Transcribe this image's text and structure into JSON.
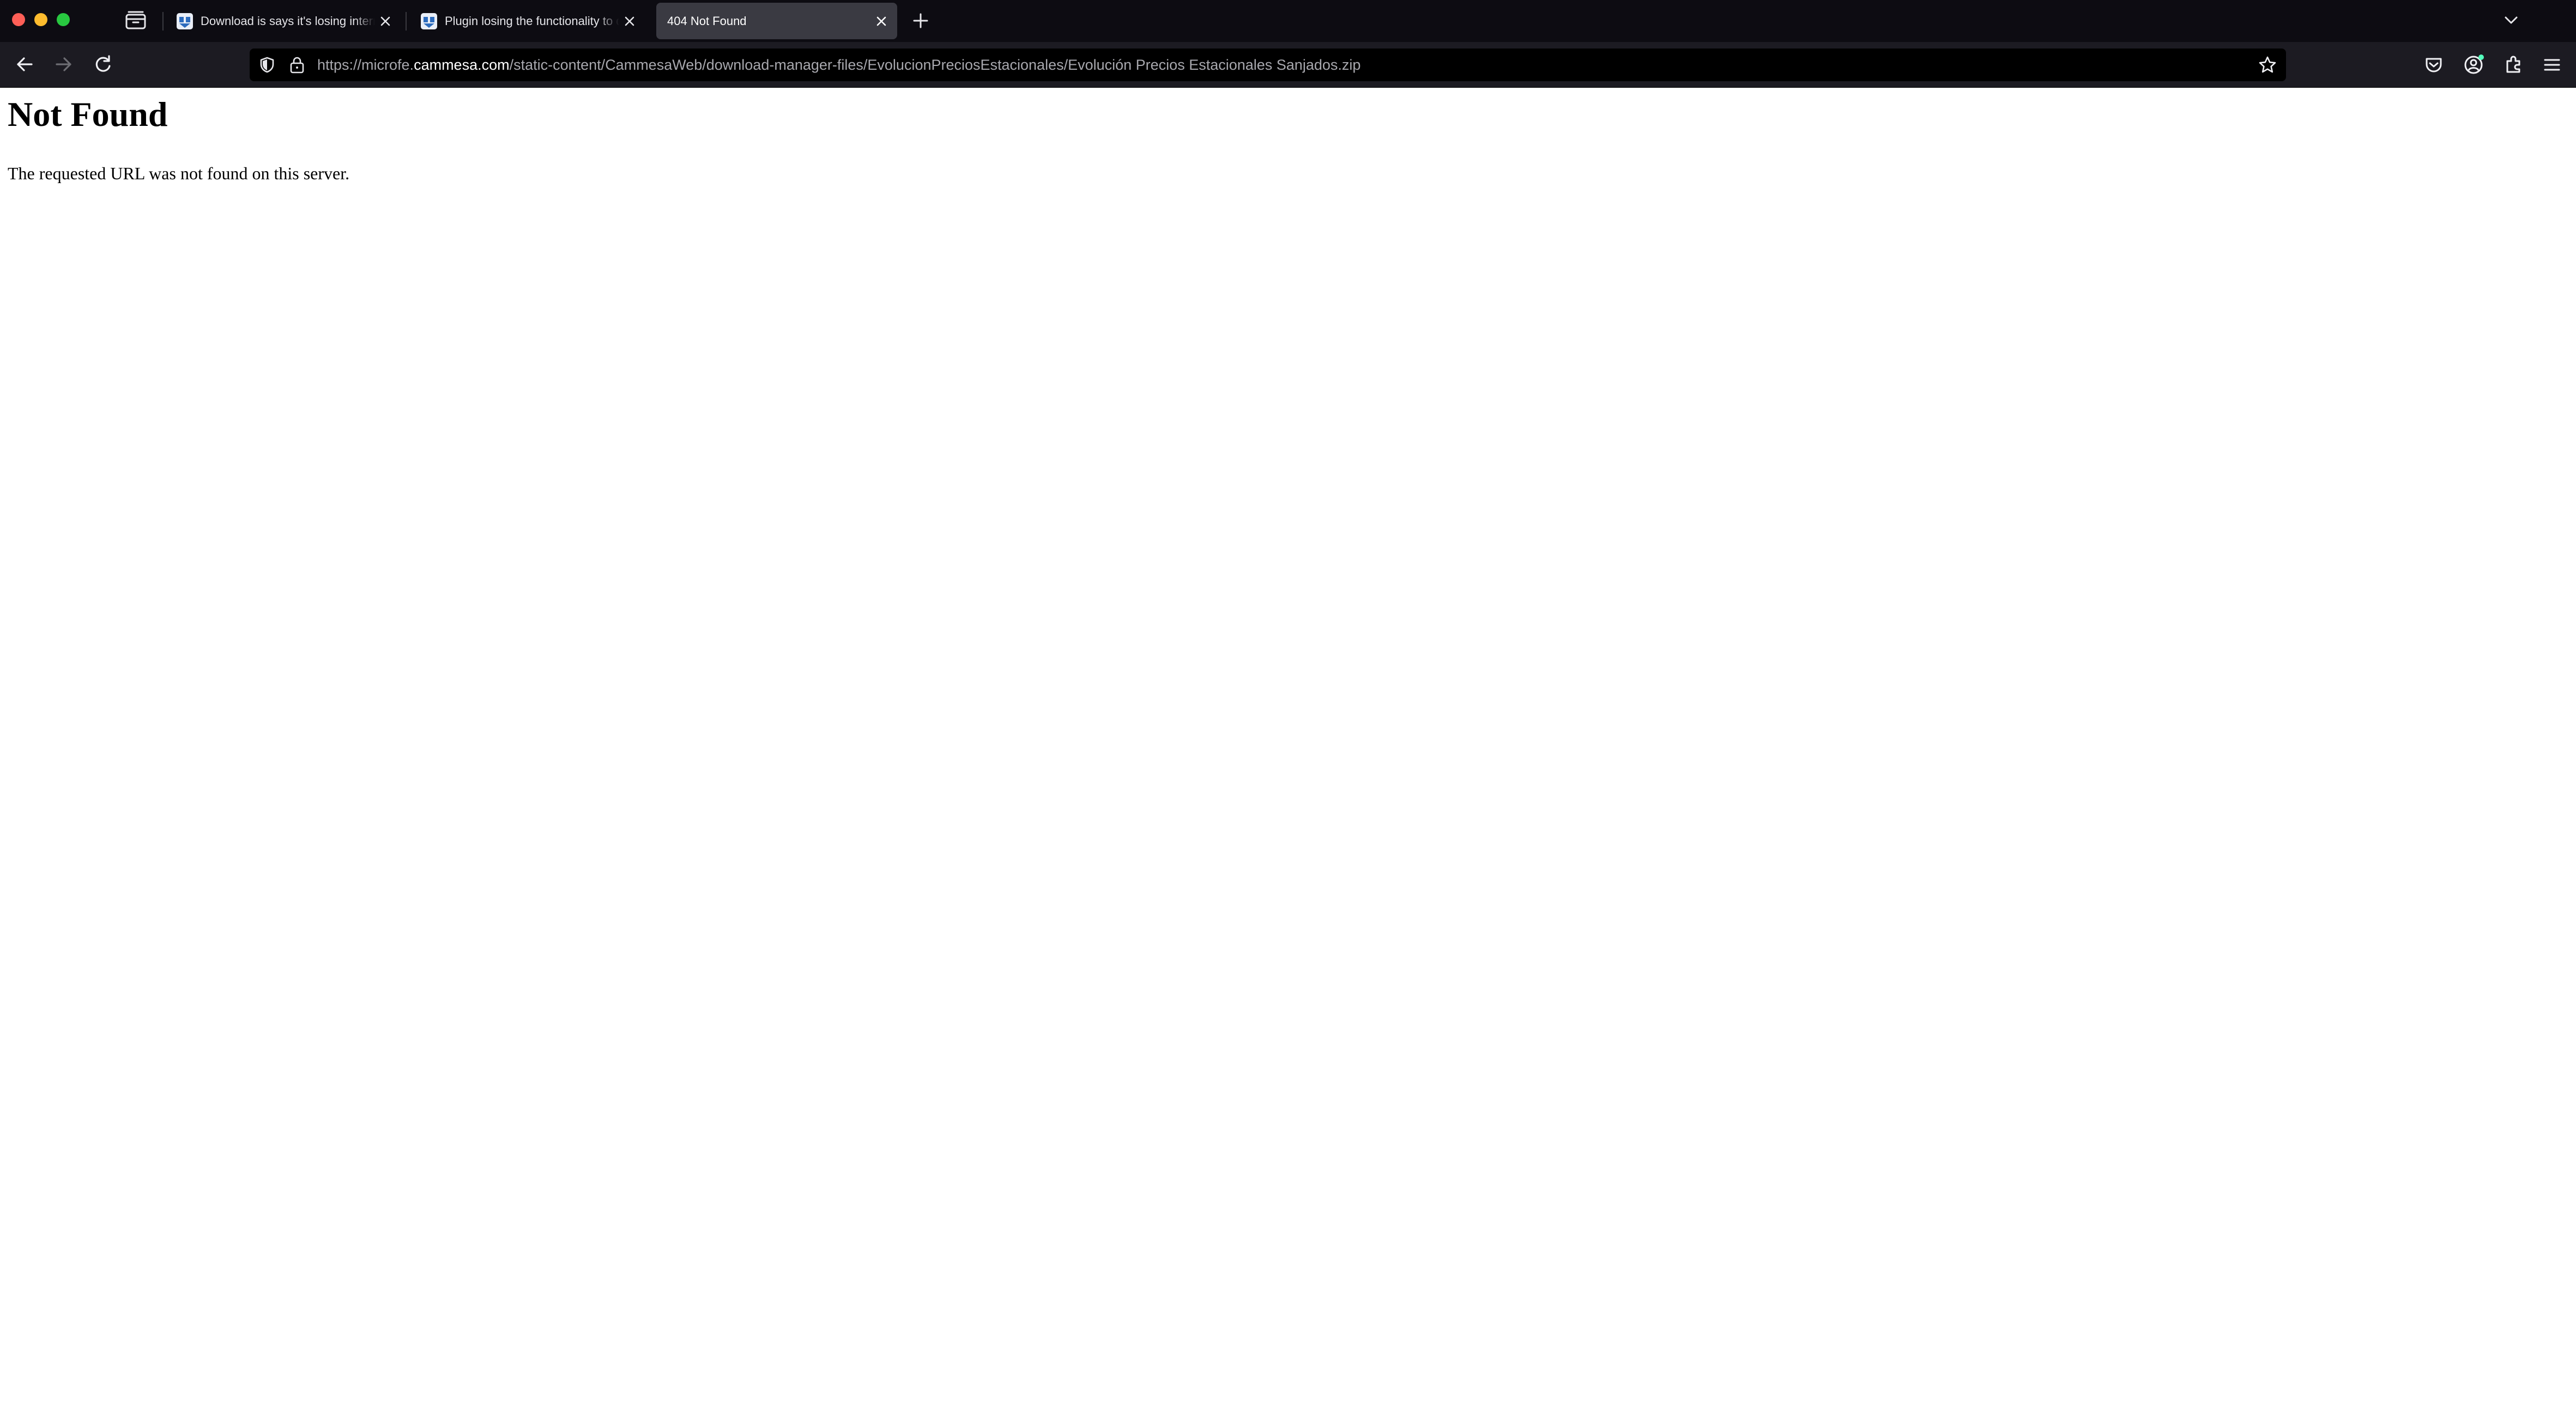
{
  "browser": {
    "tabs": [
      {
        "title": "Download is says it's losing internet connection",
        "active": false,
        "favicon": "shield-favicon-icon"
      },
      {
        "title": "Plugin losing the functionality to download files",
        "active": false,
        "favicon": "shield-favicon-icon"
      },
      {
        "title": "404 Not Found",
        "active": true,
        "favicon": null
      }
    ],
    "url": {
      "prefix": "https://microfe.",
      "host": "cammesa.com",
      "path": "/static-content/CammesaWeb/download-manager-files/EvolucionPreciosEstacionales/Evolución Precios Estacionales Sanjados.zip"
    },
    "colors": {
      "tabbar_bg": "#0d0c12",
      "toolbar_bg": "#1c1b22",
      "urlbar_bg": "#000000",
      "active_tab_bg": "#3a3a42",
      "close_red": "#fe5f57",
      "minimize_yellow": "#febc2e",
      "zoom_green": "#28c840"
    },
    "icons": [
      "tabs-overview-icon",
      "new-tab-icon",
      "list-all-tabs-icon",
      "back-icon",
      "forward-icon",
      "reload-icon",
      "shield-icon",
      "lock-icon",
      "star-icon",
      "pocket-icon",
      "account-icon",
      "extensions-icon",
      "menu-icon"
    ]
  },
  "page": {
    "heading": "Not Found",
    "message": "The requested URL was not found on this server."
  }
}
